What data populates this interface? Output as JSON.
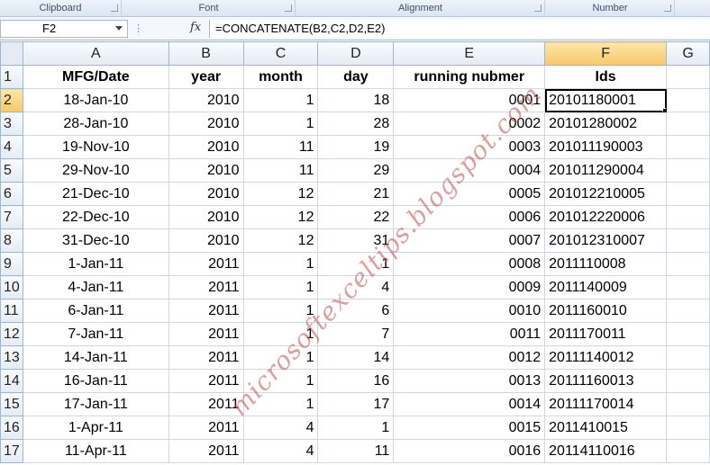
{
  "ribbon": {
    "groups": [
      "Clipboard",
      "Font",
      "Alignment",
      "Number"
    ]
  },
  "formula_bar": {
    "name_box": "F2",
    "fx_label": "fx",
    "formula": "=CONCATENATE(B2,C2,D2,E2)"
  },
  "columns": [
    "A",
    "B",
    "C",
    "D",
    "E",
    "F",
    "G"
  ],
  "header_row": {
    "row_num": "1",
    "cells": [
      "MFG/Date",
      "year",
      "month",
      "day",
      "running nubmer",
      "Ids"
    ]
  },
  "rows": [
    {
      "n": "2",
      "date": "18-Jan-10",
      "year": "2010",
      "month": "1",
      "day": "18",
      "run": "0001",
      "id": "20101180001"
    },
    {
      "n": "3",
      "date": "28-Jan-10",
      "year": "2010",
      "month": "1",
      "day": "28",
      "run": "0002",
      "id": "20101280002"
    },
    {
      "n": "4",
      "date": "19-Nov-10",
      "year": "2010",
      "month": "11",
      "day": "19",
      "run": "0003",
      "id": "201011190003"
    },
    {
      "n": "5",
      "date": "29-Nov-10",
      "year": "2010",
      "month": "11",
      "day": "29",
      "run": "0004",
      "id": "201011290004"
    },
    {
      "n": "6",
      "date": "21-Dec-10",
      "year": "2010",
      "month": "12",
      "day": "21",
      "run": "0005",
      "id": "201012210005"
    },
    {
      "n": "7",
      "date": "22-Dec-10",
      "year": "2010",
      "month": "12",
      "day": "22",
      "run": "0006",
      "id": "201012220006"
    },
    {
      "n": "8",
      "date": "31-Dec-10",
      "year": "2010",
      "month": "12",
      "day": "31",
      "run": "0007",
      "id": "201012310007"
    },
    {
      "n": "9",
      "date": "1-Jan-11",
      "year": "2011",
      "month": "1",
      "day": "1",
      "run": "0008",
      "id": "2011110008"
    },
    {
      "n": "10",
      "date": "4-Jan-11",
      "year": "2011",
      "month": "1",
      "day": "4",
      "run": "0009",
      "id": "2011140009"
    },
    {
      "n": "11",
      "date": "6-Jan-11",
      "year": "2011",
      "month": "1",
      "day": "6",
      "run": "0010",
      "id": "2011160010"
    },
    {
      "n": "12",
      "date": "7-Jan-11",
      "year": "2011",
      "month": "1",
      "day": "7",
      "run": "0011",
      "id": "2011170011"
    },
    {
      "n": "13",
      "date": "14-Jan-11",
      "year": "2011",
      "month": "1",
      "day": "14",
      "run": "0012",
      "id": "20111140012"
    },
    {
      "n": "14",
      "date": "16-Jan-11",
      "year": "2011",
      "month": "1",
      "day": "16",
      "run": "0013",
      "id": "20111160013"
    },
    {
      "n": "15",
      "date": "17-Jan-11",
      "year": "2011",
      "month": "1",
      "day": "17",
      "run": "0014",
      "id": "20111170014"
    },
    {
      "n": "16",
      "date": "1-Apr-11",
      "year": "2011",
      "month": "4",
      "day": "1",
      "run": "0015",
      "id": "2011410015"
    },
    {
      "n": "17",
      "date": "11-Apr-11",
      "year": "2011",
      "month": "4",
      "day": "11",
      "run": "0016",
      "id": "20114110016"
    }
  ],
  "watermark": "microsoftexceltips.blogspot.com"
}
